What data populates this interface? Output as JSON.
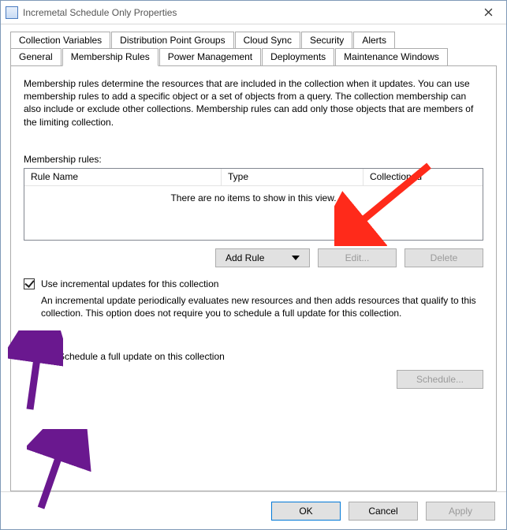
{
  "window": {
    "title": "Incremetal Schedule Only Properties",
    "close_icon": "close"
  },
  "tabs_row1": [
    {
      "label": "Collection Variables"
    },
    {
      "label": "Distribution Point Groups"
    },
    {
      "label": "Cloud Sync"
    },
    {
      "label": "Security"
    },
    {
      "label": "Alerts"
    }
  ],
  "tabs_row2": [
    {
      "label": "General"
    },
    {
      "label": "Membership Rules"
    },
    {
      "label": "Power Management"
    },
    {
      "label": "Deployments"
    },
    {
      "label": "Maintenance Windows"
    }
  ],
  "active_tab": "Membership Rules",
  "description": "Membership rules determine the resources that are included in the collection when it updates. You can use membership rules to add a specific object or a set of objects from a query. The collection membership can also include or exclude other collections. Membership rules can add only those objects that are members of the limiting collection.",
  "rules_label": "Membership rules:",
  "columns": {
    "name": "Rule Name",
    "type": "Type",
    "cid": "Collection Id"
  },
  "empty_msg": "There are no items to show in this view.",
  "buttons": {
    "add_rule": "Add Rule",
    "edit": "Edit...",
    "delete": "Delete"
  },
  "incremental": {
    "checked": true,
    "label": "Use incremental updates for this collection",
    "desc": "An incremental update periodically evaluates new resources and then adds resources that qualify to this collection. This option does not require you to schedule a full update for this collection."
  },
  "full_update": {
    "checked": false,
    "label": "Schedule a full update on this collection",
    "schedule_btn": "Schedule..."
  },
  "footer": {
    "ok": "OK",
    "cancel": "Cancel",
    "apply": "Apply"
  }
}
